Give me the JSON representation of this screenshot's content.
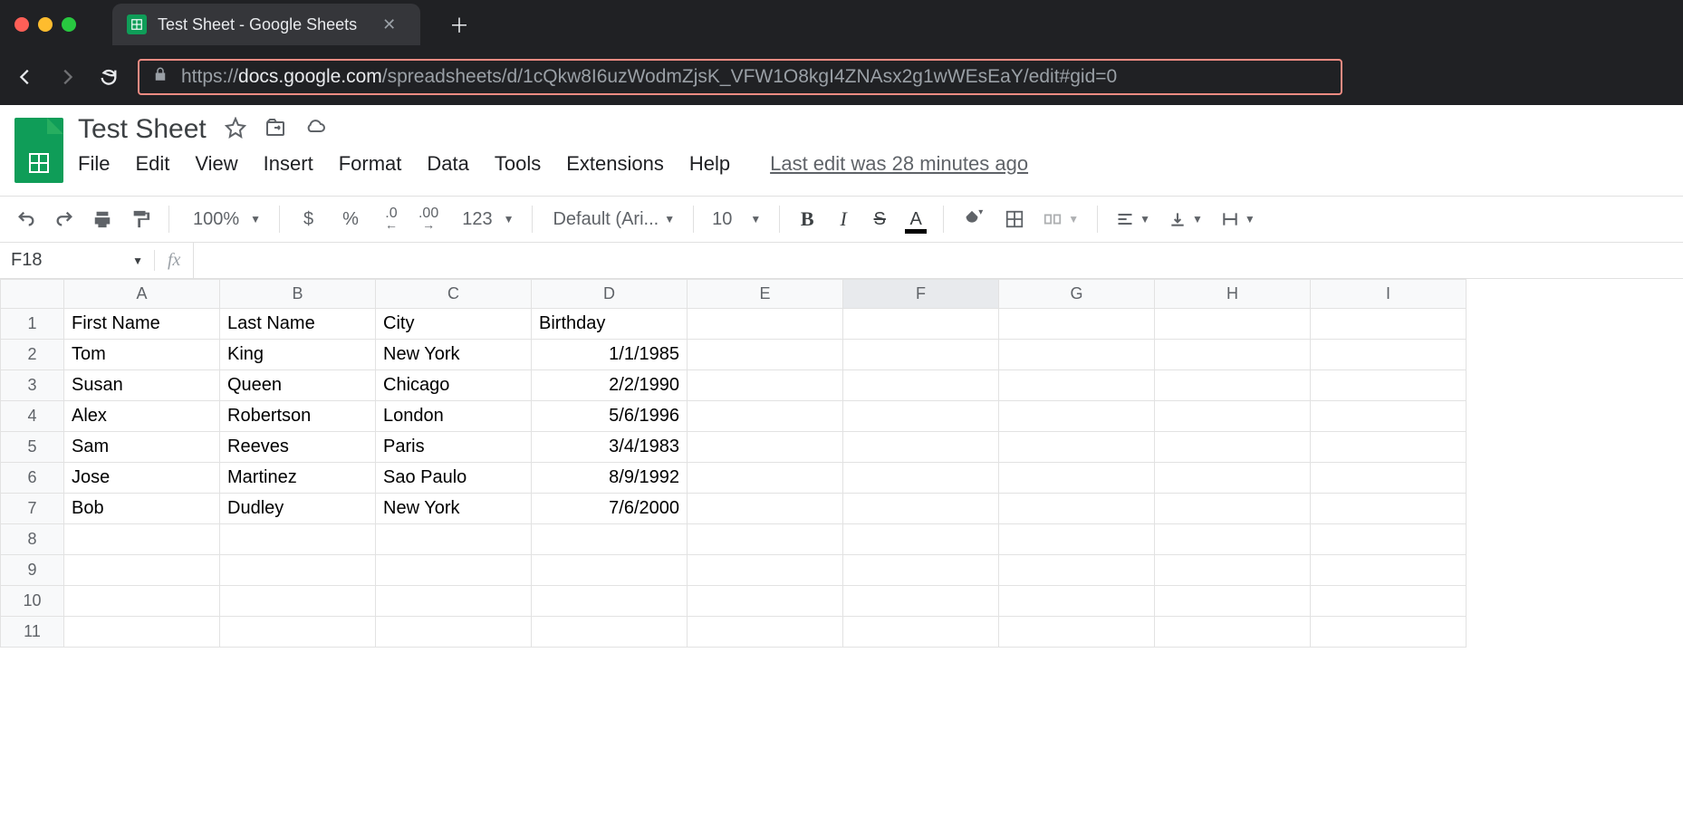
{
  "browser": {
    "tab_title": "Test Sheet - Google Sheets",
    "url_prefix": "https://",
    "url_domain": "docs.google.com",
    "url_path": "/spreadsheets/d/1cQkw8I6uzWodmZjsK_VFW1O8kgI4ZNAsx2g1wWEsEaY/edit#gid=0"
  },
  "doc": {
    "title": "Test Sheet",
    "menu": [
      "File",
      "Edit",
      "View",
      "Insert",
      "Format",
      "Data",
      "Tools",
      "Extensions",
      "Help"
    ],
    "last_edit": "Last edit was 28 minutes ago"
  },
  "toolbar": {
    "zoom": "100%",
    "currency": "$",
    "percent": "%",
    "dec_dec": ".0",
    "inc_dec": ".00",
    "more_fmt": "123",
    "font": "Default (Ari...",
    "font_size": "10",
    "bold": "B",
    "italic": "I",
    "strike": "S",
    "text_color": "A"
  },
  "name_box": "F18",
  "fx_label": "fx",
  "columns": [
    "A",
    "B",
    "C",
    "D",
    "E",
    "F",
    "G",
    "H",
    "I"
  ],
  "rows": [
    "1",
    "2",
    "3",
    "4",
    "5",
    "6",
    "7",
    "8",
    "9",
    "10",
    "11"
  ],
  "selected_col": "F",
  "cells": {
    "A1": "First Name",
    "B1": "Last Name",
    "C1": "City",
    "D1": "Birthday",
    "A2": "Tom",
    "B2": "King",
    "C2": "New York",
    "D2": "1/1/1985",
    "A3": "Susan",
    "B3": "Queen",
    "C3": "Chicago",
    "D3": "2/2/1990",
    "A4": "Alex",
    "B4": "Robertson",
    "C4": "London",
    "D4": "5/6/1996",
    "A5": "Sam",
    "B5": "Reeves",
    "C5": "Paris",
    "D5": "3/4/1983",
    "A6": "Jose",
    "B6": "Martinez",
    "C6": "Sao Paulo",
    "D6": "8/9/1992",
    "A7": "Bob",
    "B7": "Dudley",
    "C7": "New York",
    "D7": "7/6/2000"
  }
}
